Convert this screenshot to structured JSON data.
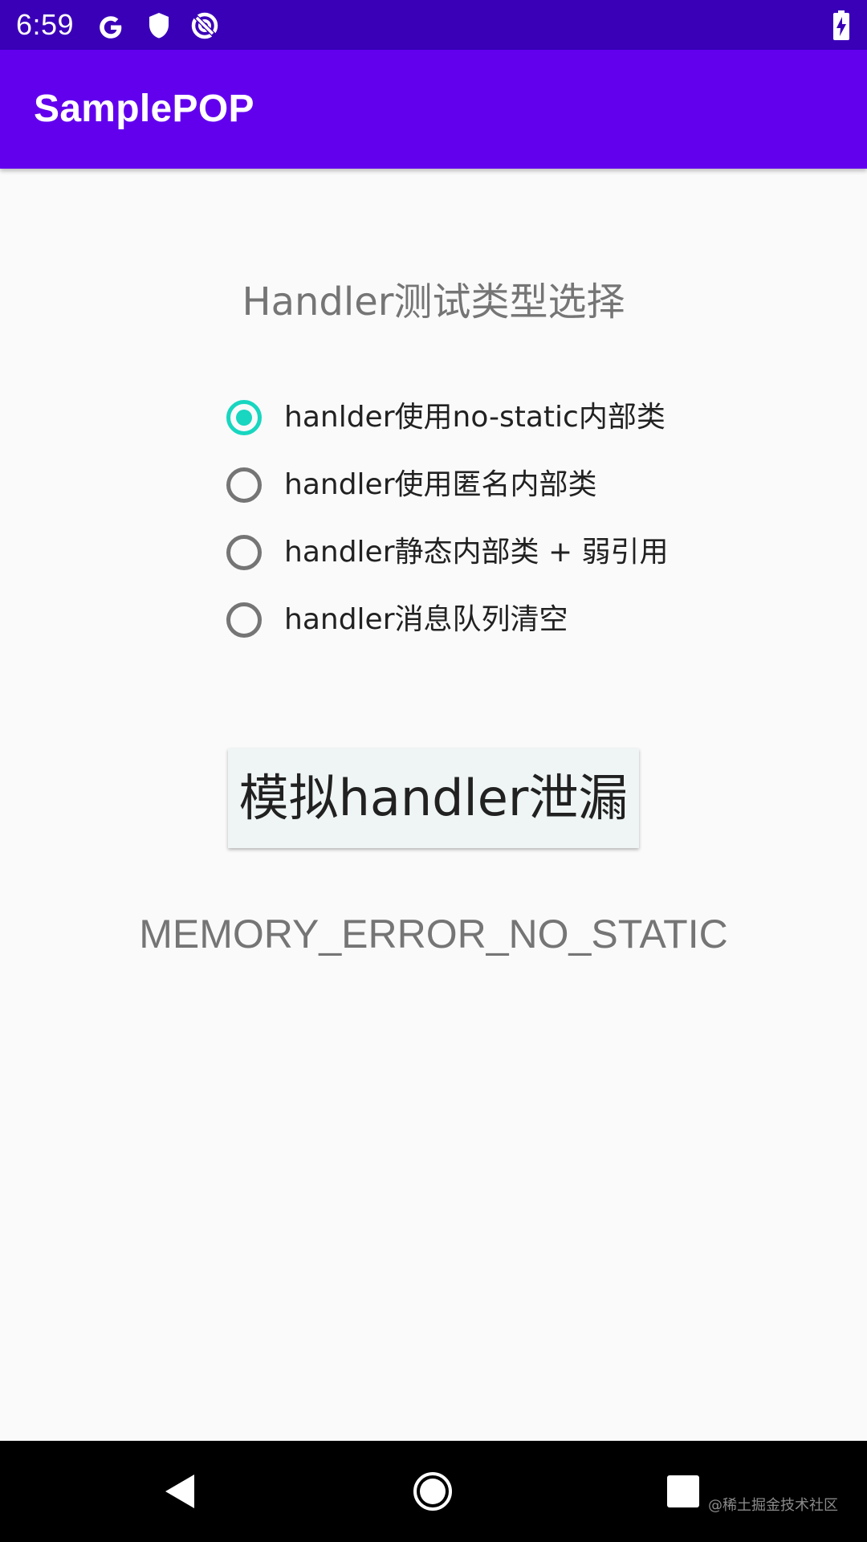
{
  "status_bar": {
    "time": "6:59",
    "icons": [
      "google-icon",
      "shield-icon",
      "data-saver-icon",
      "battery-charging-icon"
    ]
  },
  "app_bar": {
    "title": "SamplePOP"
  },
  "content": {
    "section_title": "Handler测试类型选择",
    "radio_options": [
      {
        "label": "hanlder使用no-static内部类",
        "checked": true
      },
      {
        "label": "handler使用匿名内部类",
        "checked": false
      },
      {
        "label": "handler静态内部类 + 弱引用",
        "checked": false
      },
      {
        "label": "handler消息队列清空",
        "checked": false
      }
    ],
    "button_label": "模拟handler泄漏",
    "result_text": "MEMORY_ERROR_NO_STATIC"
  },
  "nav_bar": {
    "buttons": [
      "back-icon",
      "home-icon",
      "recents-icon"
    ],
    "watermark": "@稀土掘金技术社区"
  },
  "colors": {
    "status_bar": "#3a00b8",
    "app_bar": "#6200ee",
    "accent": "#18d6c0",
    "background": "#fafafa"
  }
}
